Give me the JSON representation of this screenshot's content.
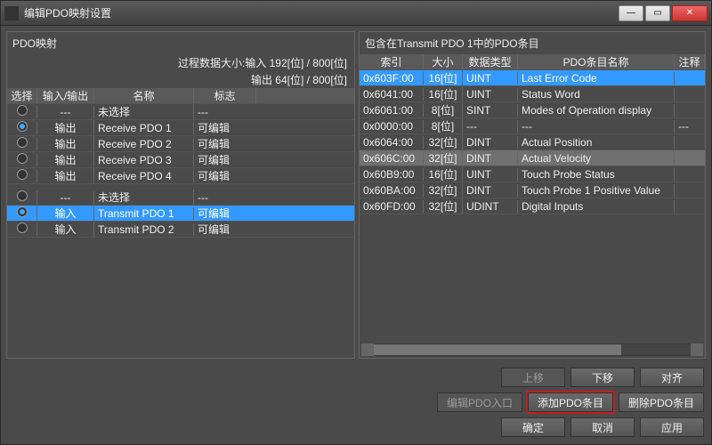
{
  "title": "编辑PDO映射设置",
  "left": {
    "title": "PDO映射",
    "stat1": "过程数据大小:输入  192[位]  /  800[位]",
    "stat2": "输出  64[位]  /  800[位]",
    "headers": {
      "c1": "选择",
      "c2": "输入/输出",
      "c3": "名称",
      "c4": "标志"
    },
    "rows": [
      {
        "sel": false,
        "io": "---",
        "name": "未选择",
        "flag": "---"
      },
      {
        "sel": true,
        "io": "输出",
        "name": "Receive PDO 1",
        "flag": "可编辑"
      },
      {
        "sel": false,
        "io": "输出",
        "name": "Receive PDO 2",
        "flag": "可编辑"
      },
      {
        "sel": false,
        "io": "输出",
        "name": "Receive PDO 3",
        "flag": "可编辑"
      },
      {
        "sel": false,
        "io": "输出",
        "name": "Receive PDO 4",
        "flag": "可编辑"
      },
      {
        "sel": false,
        "io": "---",
        "name": "未选择",
        "flag": "---",
        "gap": true
      },
      {
        "sel": true,
        "io": "输入",
        "name": "Transmit PDO 1",
        "flag": "可编辑",
        "highlight": true
      },
      {
        "sel": false,
        "io": "输入",
        "name": "Transmit PDO 2",
        "flag": "可编辑"
      }
    ]
  },
  "right": {
    "title": "包含在Transmit PDO 1中的PDO条目",
    "headers": {
      "c1": "索引",
      "c2": "大小",
      "c3": "数据类型",
      "c4": "PDO条目名称",
      "c5": "注释"
    },
    "rows": [
      {
        "idx": "0x603F:00",
        "size": "16[位]",
        "dtype": "UINT",
        "name": "Last Error Code",
        "sel": true
      },
      {
        "idx": "0x6041:00",
        "size": "16[位]",
        "dtype": "UINT",
        "name": "Status Word"
      },
      {
        "idx": "0x6061:00",
        "size": "8[位]",
        "dtype": "SINT",
        "name": "Modes of Operation display"
      },
      {
        "idx": "0x0000:00",
        "size": "8[位]",
        "dtype": "---",
        "name": "---",
        "note": "---"
      },
      {
        "idx": "0x6064:00",
        "size": "32[位]",
        "dtype": "DINT",
        "name": "Actual Position"
      },
      {
        "idx": "0x606C:00",
        "size": "32[位]",
        "dtype": "DINT",
        "name": "Actual Velocity",
        "hl": true
      },
      {
        "idx": "0x60B9:00",
        "size": "16[位]",
        "dtype": "UINT",
        "name": "Touch Probe Status"
      },
      {
        "idx": "0x60BA:00",
        "size": "32[位]",
        "dtype": "DINT",
        "name": "Touch Probe 1 Positive Value"
      },
      {
        "idx": "0x60FD:00",
        "size": "32[位]",
        "dtype": "UDINT",
        "name": "Digital Inputs"
      }
    ]
  },
  "buttons": {
    "row1": {
      "up": "上移",
      "down": "下移",
      "align": "对齐"
    },
    "row2": {
      "editEntry": "编辑PDO入口",
      "addEntry": "添加PDO条目",
      "delEntry": "删除PDO条目"
    },
    "row3": {
      "ok": "确定",
      "cancel": "取消",
      "apply": "应用"
    }
  }
}
